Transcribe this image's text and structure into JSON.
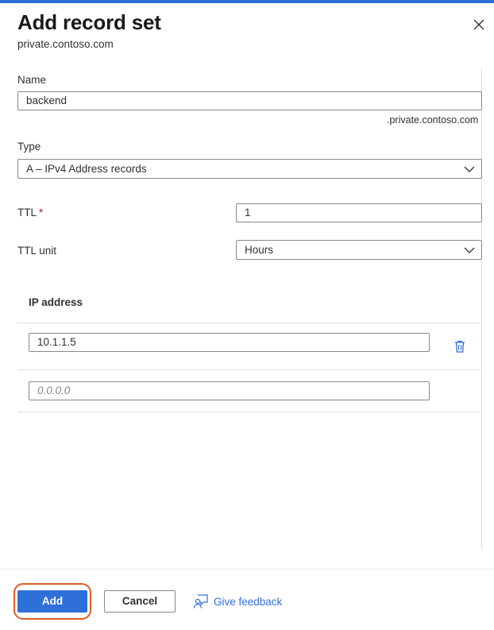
{
  "panel": {
    "title": "Add record set",
    "subtitle": "private.contoso.com"
  },
  "form": {
    "name_label": "Name",
    "name_value": "backend",
    "name_suffix": ".private.contoso.com",
    "type_label": "Type",
    "type_value": "A – IPv4 Address records",
    "ttl_label": "TTL",
    "ttl_required": "*",
    "ttl_value": "1",
    "ttl_unit_label": "TTL unit",
    "ttl_unit_value": "Hours"
  },
  "ip_grid": {
    "header": "IP address",
    "rows": [
      {
        "value": "10.1.1.5"
      }
    ],
    "new_row_placeholder": "0.0.0.0"
  },
  "footer": {
    "add_label": "Add",
    "cancel_label": "Cancel",
    "feedback_label": "Give feedback"
  },
  "icons": {
    "close": "close-icon",
    "dropdown": "chevron-down-icon",
    "delete": "trash-icon",
    "feedback": "feedback-icon"
  },
  "colors": {
    "accent": "#2f6fd8",
    "highlight_ring": "#e05a27",
    "required": "#a4262c"
  }
}
